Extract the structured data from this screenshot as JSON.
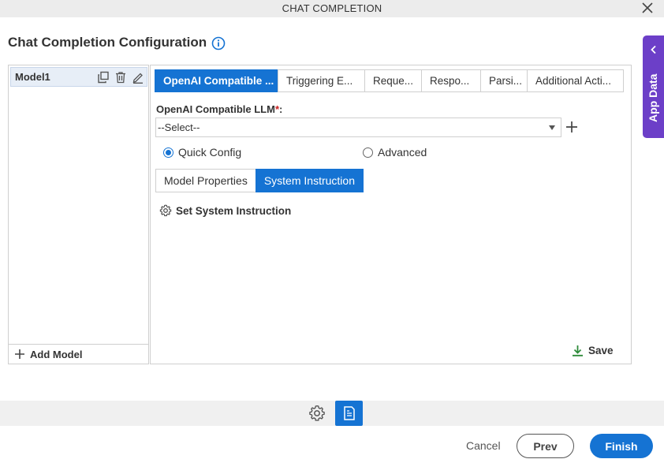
{
  "window": {
    "title": "CHAT COMPLETION",
    "close_icon": "close-icon"
  },
  "heading": {
    "title": "Chat Completion Configuration",
    "info_icon": "info-icon"
  },
  "models": {
    "items": [
      {
        "label": "Model1"
      }
    ],
    "add_label": "Add Model"
  },
  "tabs": [
    {
      "label": "OpenAI Compatible ...",
      "active": true
    },
    {
      "label": "Triggering E..."
    },
    {
      "label": "Reque..."
    },
    {
      "label": "Respo..."
    },
    {
      "label": "Parsi..."
    },
    {
      "label": "Additional Acti..."
    }
  ],
  "llm": {
    "label": "OpenAI Compatible LLM",
    "required_mark": "*",
    "label_suffix": ":",
    "selected": "--Select--"
  },
  "config_mode": {
    "options": [
      {
        "label": "Quick Config",
        "checked": true
      },
      {
        "label": "Advanced",
        "checked": false
      }
    ]
  },
  "subtabs": [
    {
      "label": "Model Properties"
    },
    {
      "label": "System Instruction",
      "active": true
    }
  ],
  "set_instruction": {
    "label": "Set System Instruction"
  },
  "save": {
    "label": "Save"
  },
  "side_panel": {
    "label": "App Data"
  },
  "footer": {
    "cancel": "Cancel",
    "prev": "Prev",
    "finish": "Finish"
  },
  "colors": {
    "accent": "#1573d3",
    "side_panel": "#6c3fc8",
    "required": "#c91f1f",
    "save_icon": "#2e8b3a"
  }
}
